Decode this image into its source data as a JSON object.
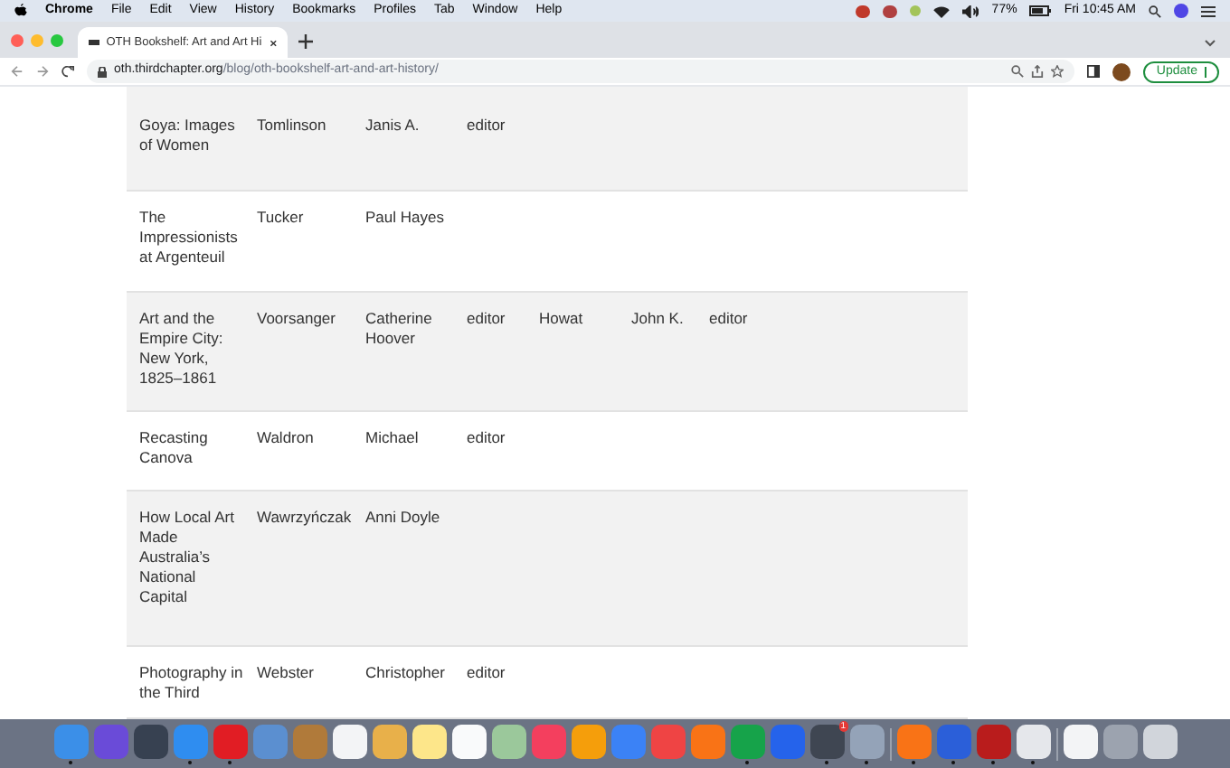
{
  "menu_bar": {
    "app": "Chrome",
    "items": [
      "File",
      "Edit",
      "View",
      "History",
      "Bookmarks",
      "Profiles",
      "Tab",
      "Window",
      "Help"
    ],
    "battery": "77%",
    "clock": "Fri 10:45 AM"
  },
  "tab": {
    "title": "OTH Bookshelf: Art and Art Hi",
    "selected": true
  },
  "address_bar": {
    "domain": "oth.thirdchapter.org",
    "path": "/blog/oth-bookshelf-art-and-art-history/",
    "update_button": "Update"
  },
  "table": {
    "rows": [
      {
        "cells": [
          "Goya: Images of Women",
          "Tomlinson",
          "Janis A.",
          "editor"
        ]
      },
      {
        "cells": [
          "The Impressionists at Argenteuil",
          "Tucker",
          "Paul Hayes"
        ]
      },
      {
        "cells": [
          "Art and the Empire City: New York, 1825–1861",
          "Voorsanger",
          "Catherine Hoover",
          "editor",
          "Howat",
          "John K.",
          "editor"
        ]
      },
      {
        "cells": [
          "Recasting Canova",
          "Waldron",
          "Michael",
          "editor"
        ]
      },
      {
        "cells": [
          "How Local Art Made Australia’s National Capital",
          "Wawrzyńczak",
          "Anni Doyle"
        ]
      },
      {
        "cells": [
          "Photography in the Third",
          "Webster",
          "Christopher",
          "editor"
        ]
      }
    ]
  },
  "dock": {
    "apps": [
      {
        "running": true
      },
      {
        "running": false
      },
      {
        "running": false
      },
      {
        "running": true
      },
      {
        "running": true
      },
      {
        "running": false
      },
      {
        "running": false
      },
      {
        "running": false
      },
      {
        "running": false
      },
      {
        "running": false
      },
      {
        "running": false
      },
      {
        "running": false
      },
      {
        "running": false
      },
      {
        "running": false
      },
      {
        "running": false
      },
      {
        "running": false
      },
      {
        "running": false
      },
      {
        "running": true
      },
      {
        "running": false
      },
      {
        "running": true,
        "badge": "1"
      },
      {
        "running": true
      },
      {
        "running": true
      },
      {
        "running": true
      },
      {
        "running": true
      },
      {
        "running": true
      },
      {
        "running": false
      },
      {
        "running": false
      },
      {
        "running": false
      }
    ]
  }
}
